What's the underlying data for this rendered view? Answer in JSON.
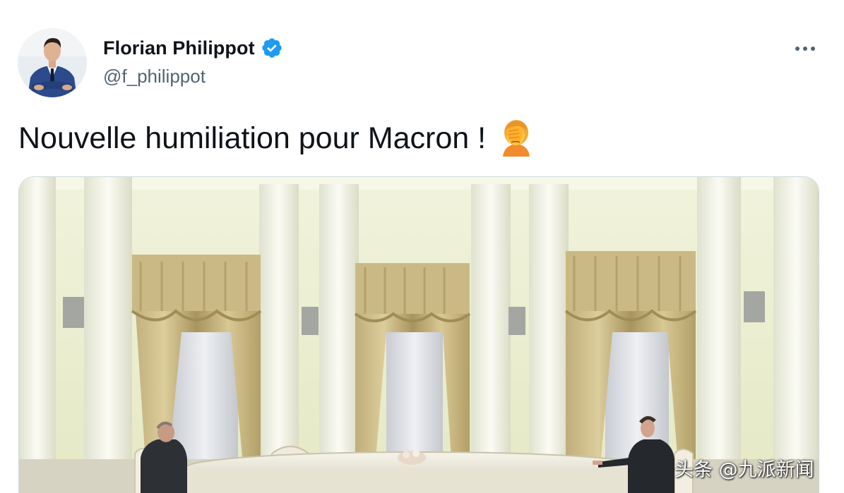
{
  "tweet": {
    "author": {
      "display_name": "Florian Philippot",
      "handle": "@f_philippot",
      "verified": true,
      "verified_icon": "verified-badge-icon"
    },
    "more_icon": "more-horizontal-icon",
    "text": "Nouvelle humiliation pour Macron !",
    "emoji": "person-facepalming-emoji",
    "media": {
      "type": "photo"
    }
  },
  "watermark": {
    "text": "头条 @九派新闻"
  },
  "colors": {
    "verified_blue": "#1d9bf0",
    "text_primary": "#0f1419",
    "text_secondary": "#536471",
    "border": "#cfd9de"
  }
}
